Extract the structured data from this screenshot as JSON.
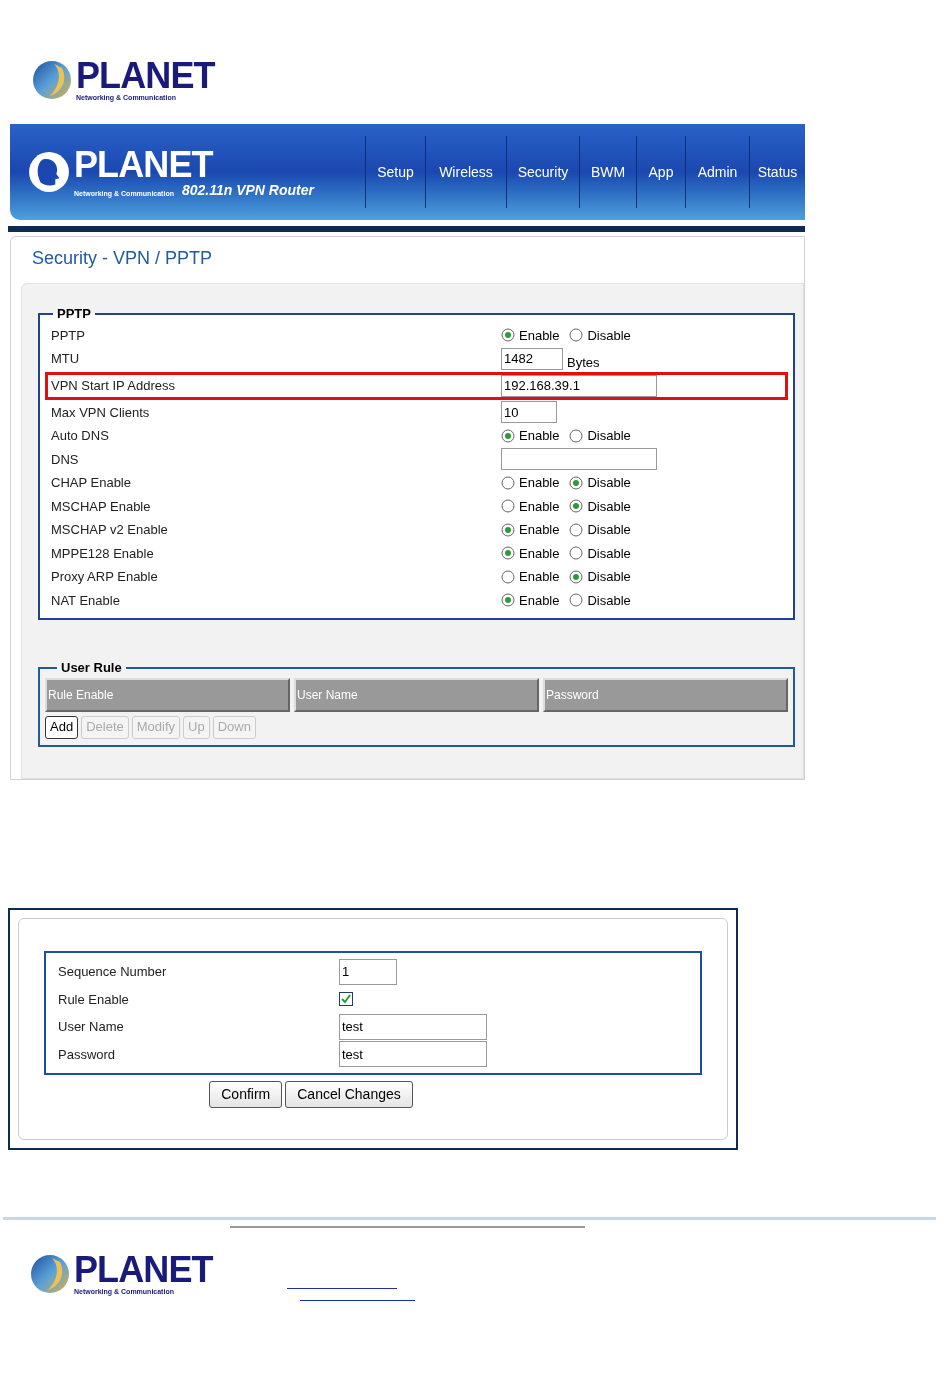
{
  "top_logo": {
    "name": "PLANET",
    "tagline": "Networking & Communication"
  },
  "router_header": {
    "brand": "PLANET",
    "tagline": "Networking & Communication",
    "product": "802.11n VPN Router",
    "tabs": [
      "Setup",
      "Wireless",
      "Security",
      "BWM",
      "App",
      "Admin",
      "Status"
    ]
  },
  "page_title": "Security - VPN / PPTP",
  "pptp": {
    "legend": "PPTP",
    "rows": [
      {
        "label": "PPTP",
        "kind": "radio",
        "highlighted": false,
        "options": [
          {
            "label": "Enable",
            "selected": true
          },
          {
            "label": "Disable",
            "selected": false
          }
        ]
      },
      {
        "label": "MTU",
        "kind": "short_input",
        "highlighted": false,
        "value": "1482",
        "unit": "Bytes"
      },
      {
        "label": "VPN Start IP Address",
        "kind": "input",
        "highlighted": true,
        "value": "192.168.39.1"
      },
      {
        "label": "Max VPN Clients",
        "kind": "short_input",
        "highlighted": false,
        "value": "10"
      },
      {
        "label": "Auto DNS",
        "kind": "radio",
        "highlighted": false,
        "options": [
          {
            "label": "Enable",
            "selected": true
          },
          {
            "label": "Disable",
            "selected": false
          }
        ]
      },
      {
        "label": "DNS",
        "kind": "input",
        "highlighted": false,
        "value": ""
      },
      {
        "label": "CHAP Enable",
        "kind": "radio",
        "highlighted": false,
        "options": [
          {
            "label": "Enable",
            "selected": false
          },
          {
            "label": "Disable",
            "selected": true
          }
        ]
      },
      {
        "label": "MSCHAP Enable",
        "kind": "radio",
        "highlighted": false,
        "options": [
          {
            "label": "Enable",
            "selected": false
          },
          {
            "label": "Disable",
            "selected": true
          }
        ]
      },
      {
        "label": "MSCHAP v2 Enable",
        "kind": "radio",
        "highlighted": false,
        "options": [
          {
            "label": "Enable",
            "selected": true
          },
          {
            "label": "Disable",
            "selected": false
          }
        ]
      },
      {
        "label": "MPPE128 Enable",
        "kind": "radio",
        "highlighted": false,
        "options": [
          {
            "label": "Enable",
            "selected": true
          },
          {
            "label": "Disable",
            "selected": false
          }
        ]
      },
      {
        "label": "Proxy ARP Enable",
        "kind": "radio",
        "highlighted": false,
        "options": [
          {
            "label": "Enable",
            "selected": false
          },
          {
            "label": "Disable",
            "selected": true
          }
        ]
      },
      {
        "label": "NAT Enable",
        "kind": "radio",
        "highlighted": false,
        "options": [
          {
            "label": "Enable",
            "selected": true
          },
          {
            "label": "Disable",
            "selected": false
          }
        ]
      }
    ]
  },
  "user_rule": {
    "legend": "User Rule",
    "columns": [
      "Rule Enable",
      "User Name",
      "Password"
    ],
    "buttons": [
      {
        "label": "Add",
        "disabled": false
      },
      {
        "label": "Delete",
        "disabled": true
      },
      {
        "label": "Modify",
        "disabled": true
      },
      {
        "label": "Up",
        "disabled": true
      },
      {
        "label": "Down",
        "disabled": true
      }
    ]
  },
  "rule_dialog": {
    "fields": [
      {
        "label": "Sequence Number",
        "kind": "short_input",
        "value": "1"
      },
      {
        "label": "Rule Enable",
        "kind": "checkbox",
        "checked": true
      },
      {
        "label": "User Name",
        "kind": "input",
        "value": "test"
      },
      {
        "label": "Password",
        "kind": "input",
        "value": "test"
      }
    ],
    "buttons": [
      "Confirm",
      "Cancel Changes"
    ]
  },
  "footer_logo": {
    "name": "PLANET",
    "tagline": "Networking & Communication"
  }
}
